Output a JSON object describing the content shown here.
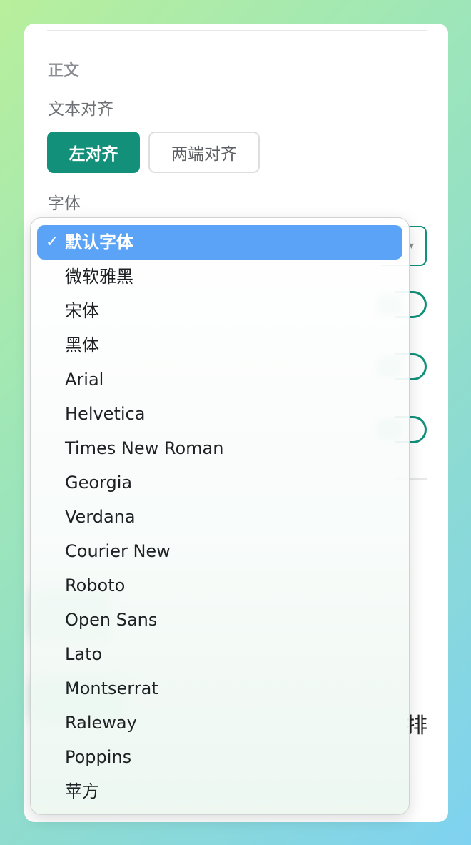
{
  "section": {
    "title": "正文"
  },
  "text_align": {
    "label": "文本对齐",
    "left_label": "左对齐",
    "justify_label": "两端对齐",
    "selected": "左对齐"
  },
  "font": {
    "label": "字体",
    "selected": "默认字体",
    "options": [
      "默认字体",
      "微软雅黑",
      "宋体",
      "黑体",
      "Arial",
      "Helvetica",
      "Times New Roman",
      "Georgia",
      "Verdana",
      "Courier New",
      "Roboto",
      "Open Sans",
      "Lato",
      "Montserrat",
      "Raleway",
      "Poppins",
      "苹方"
    ]
  },
  "partial_text": {
    "right_edge_char": "排"
  },
  "colors": {
    "accent": "#12907a",
    "dropdown_highlight": "#5ba3f6",
    "background_start": "#b8ef9c",
    "background_end": "#7fd2f0"
  },
  "icons": {
    "checkmark": "check-icon",
    "select_arrow": "chevron-down-icon"
  }
}
